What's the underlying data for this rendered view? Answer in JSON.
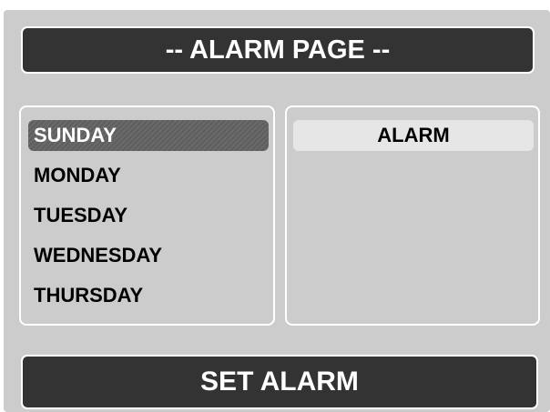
{
  "header": {
    "title": "-- ALARM PAGE --"
  },
  "days": {
    "selected_index": 0,
    "items": [
      "SUNDAY",
      "MONDAY",
      "TUESDAY",
      "WEDNESDAY",
      "THURSDAY"
    ]
  },
  "alarm_panel": {
    "header": "ALARM"
  },
  "actions": {
    "set_alarm_label": "SET ALARM"
  }
}
